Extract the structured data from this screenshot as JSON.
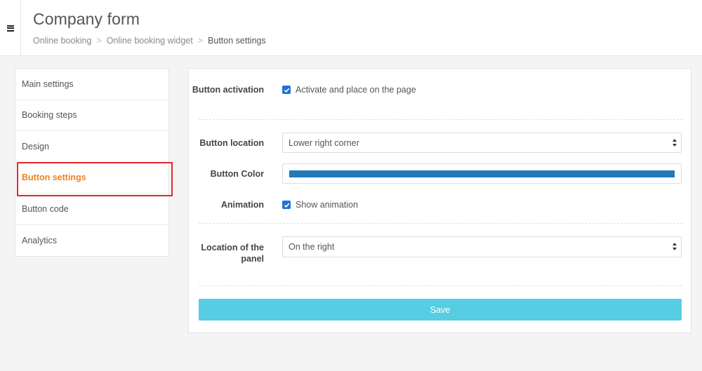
{
  "header": {
    "title": "Company form",
    "breadcrumb": {
      "item1": "Online booking",
      "item2": "Online booking widget",
      "current": "Button settings",
      "separator": ">"
    },
    "menu_icon": "hamburger-menu-icon"
  },
  "sidebar": {
    "items": [
      {
        "label": "Main settings"
      },
      {
        "label": "Booking steps"
      },
      {
        "label": "Design"
      },
      {
        "label": "Button settings",
        "active": true
      },
      {
        "label": "Button code"
      },
      {
        "label": "Analytics"
      }
    ]
  },
  "form": {
    "activation": {
      "label": "Button activation",
      "checkbox_label": "Activate and place on the page",
      "checked": true
    },
    "location": {
      "label": "Button location",
      "value": "Lower right corner"
    },
    "color": {
      "label": "Button Color",
      "value": "#2379b9"
    },
    "animation": {
      "label": "Animation",
      "checkbox_label": "Show animation",
      "checked": true
    },
    "panel_location": {
      "label": "Location of the panel",
      "value": "On the right"
    },
    "save_label": "Save"
  },
  "colors": {
    "accent_orange": "#f08122",
    "highlight_red": "#e3262c",
    "save_button": "#56cde3",
    "checkbox": "#1f73d6"
  }
}
